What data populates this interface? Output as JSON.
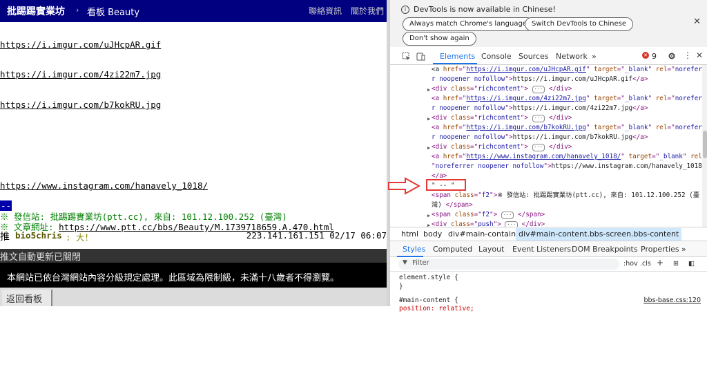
{
  "ptt": {
    "site_title": "批踢踢實業坊",
    "separator": "›",
    "board": "看板 Beauty",
    "nav_links": [
      "聯絡資訊",
      "關於我們"
    ],
    "image_links": [
      "https://i.imgur.com/uJHcpAR.gif",
      "https://i.imgur.com/4zi22m7.jpg",
      "https://i.imgur.com/b7kokRU.jpg"
    ],
    "instagram_link": "https://www.instagram.com/hanavely_1018/",
    "signature_dash": "--",
    "origin_line": "※ 發信站: 批踢踢實業坊(ptt.cc), 來自: 101.12.100.252 (臺灣)",
    "url_prefix": "※ 文章網址: ",
    "url_link": "https://www.ptt.cc/bbs/Beauty/M.1739718659.A.470.html",
    "push": {
      "tag": "推",
      "userid": "bio5chris",
      "content": ": 大！",
      "ipdatetime": "223.141.161.151 02/17 06:07"
    },
    "auto_update": "推文自動更新已關閉",
    "warning": "本網站已依台灣網站內容分級規定處理。此區域為限制級，未滿十八歲者不得瀏覽。",
    "back_button": "返回看板"
  },
  "devtools": {
    "info_icon": "i",
    "info_text": "DevTools is now available in Chinese!",
    "info_buttons": [
      "Always match Chrome's language",
      "Switch DevTools to Chinese",
      "Don't show again"
    ],
    "close_symbol": "✕",
    "tabs": [
      "Elements",
      "Console",
      "Sources",
      "Network",
      "»"
    ],
    "active_tab": "Elements",
    "error_count": "9",
    "elements_lines": [
      {
        "html": "<span class=\"tx\">&lt;a </span><span class=\"an\">href</span>=\"<span class=\"avl\">https://i.imgur.com/uJHcpAR.gif</span>\" <span class=\"an\">target</span>=\"<span class=\"av\">_blank</span>\" <span class=\"an\">rel</span>=\"<span class=\"av\">noreferre</span>"
      },
      {
        "html": "<span class=\"av\">r noopener nofollow</span>\"&gt;<span class=\"tx\">https://i.imgur.com/uJHcpAR.gif</span>&lt;/a&gt;"
      },
      {
        "html": "&lt;div <span class=\"an\">class</span>=\"<span class=\"av\">richcontent</span>\"&gt; <span class=\"dots\">···</span> &lt;/div&gt;",
        "arrow": true
      },
      {
        "html": "&lt;a <span class=\"an\">href</span>=\"<span class=\"avl\">https://i.imgur.com/4zi22m7.jpg</span>\" <span class=\"an\">target</span>=\"<span class=\"av\">_blank</span>\" <span class=\"an\">rel</span>=\"<span class=\"av\">noreferre</span>"
      },
      {
        "html": "<span class=\"av\">r noopener nofollow</span>\"&gt;<span class=\"tx\">https://i.imgur.com/4zi22m7.jpg</span>&lt;/a&gt;"
      },
      {
        "html": "&lt;div <span class=\"an\">class</span>=\"<span class=\"av\">richcontent</span>\"&gt; <span class=\"dots\">···</span> &lt;/div&gt;",
        "arrow": true
      },
      {
        "html": "&lt;a <span class=\"an\">href</span>=\"<span class=\"avl\">https://i.imgur.com/b7kokRU.jpg</span>\" <span class=\"an\">target</span>=\"<span class=\"av\">_blank</span>\" <span class=\"an\">rel</span>=\"<span class=\"av\">noreferre</span>"
      },
      {
        "html": "<span class=\"av\">r noopener nofollow</span>\"&gt;<span class=\"tx\">https://i.imgur.com/b7kokRU.jpg</span>&lt;/a&gt;"
      },
      {
        "html": "&lt;div <span class=\"an\">class</span>=\"<span class=\"av\">richcontent</span>\"&gt; <span class=\"dots\">···</span> &lt;/div&gt;",
        "arrow": true
      },
      {
        "html": "&lt;a <span class=\"an\">href</span>=\"<span class=\"avl\">https://www.instagram.com/hanavely_1018/</span>\" <span class=\"an\">target</span>=\"<span class=\"av\">_blank</span>\" <span class=\"an\">rel</span>="
      },
      {
        "html": "\"<span class=\"av\">noreferrer noopener nofollow</span>\"&gt;<span class=\"tx\">https://www.instagram.com/hanavely_1018/</span>"
      },
      {
        "html": "&lt;/a&gt;"
      },
      {
        "html": "<span class=\"tx\">\" -- \"</span>"
      },
      {
        "html": "&lt;span <span class=\"an\">class</span>=\"<span class=\"av\">f2</span>\"&gt;<span class=\"tx\">※ 發信站: 批踢踢實業坊(ptt.cc), 來自: 101.12.100.252 (臺</span>"
      },
      {
        "html": "<span class=\"tx\">灣)</span> &lt;/span&gt;"
      },
      {
        "html": "&lt;span <span class=\"an\">class</span>=\"<span class=\"av\">f2</span>\"&gt; <span class=\"dots\">···</span> &lt;/span&gt;",
        "arrow": true
      },
      {
        "html": "&lt;div <span class=\"an\">class</span>=\"<span class=\"av\">push</span>\"&gt; <span class=\"dots\">···</span> &lt;/div&gt;",
        "arrow": true
      }
    ],
    "breadcrumbs": [
      "html",
      "body",
      "div#main-container",
      "div#main-content.bbs-screen.bbs-content"
    ],
    "pane_tabs": [
      "Styles",
      "Computed",
      "Layout",
      "Event Listeners",
      "DOM Breakpoints",
      "Properties",
      "»"
    ],
    "active_pane_tab": "Styles",
    "filter_placeholder": "Filter",
    "filter_tools": [
      ":hov",
      ".cls",
      "+",
      "⊞",
      "◧"
    ],
    "style_rules": [
      "element.style {",
      "}",
      "#main-content {",
      "    position: relative;"
    ],
    "style_source": "bbs-base.css:120"
  },
  "colors": {
    "ptt_header": "#000080",
    "accent": "#1a73e8",
    "highlight_box": "#e53935",
    "ptt_green": "#008000"
  }
}
